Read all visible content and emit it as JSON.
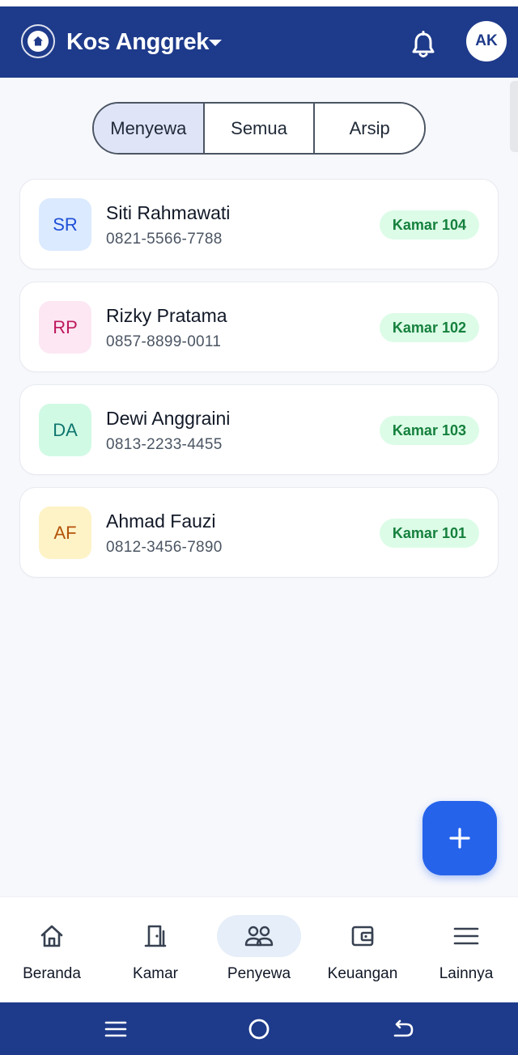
{
  "app": {
    "property_name": "Kos Anggrek",
    "user_initials": "AK"
  },
  "icons": {
    "logo": "home-circle-icon",
    "dropdown": "caret-down-icon",
    "notifications": "bell-icon",
    "fab": "plus-icon"
  },
  "filter_tabs": [
    {
      "label": "Menyewa",
      "active": true
    },
    {
      "label": "Semua",
      "active": false
    },
    {
      "label": "Arsip",
      "active": false
    }
  ],
  "tenants": [
    {
      "initials": "SR",
      "name": "Siti Rahmawati",
      "phone": "0821-5566-7788",
      "room": "Kamar 104",
      "avatar_bg": "#dbeafe",
      "avatar_fg": "#1d4ed8"
    },
    {
      "initials": "RP",
      "name": "Rizky Pratama",
      "phone": "0857-8899-0011",
      "room": "Kamar 102",
      "avatar_bg": "#fce7f3",
      "avatar_fg": "#be185d"
    },
    {
      "initials": "DA",
      "name": "Dewi Anggraini",
      "phone": "0813-2233-4455",
      "room": "Kamar 103",
      "avatar_bg": "#d1fae5",
      "avatar_fg": "#0f766e"
    },
    {
      "initials": "AF",
      "name": "Ahmad Fauzi",
      "phone": "0812-3456-7890",
      "room": "Kamar 101",
      "avatar_bg": "#fef3c7",
      "avatar_fg": "#b45309"
    }
  ],
  "bottom_nav": [
    {
      "label": "Beranda",
      "icon": "home-icon",
      "active": false
    },
    {
      "label": "Kamar",
      "icon": "door-icon",
      "active": false
    },
    {
      "label": "Penyewa",
      "icon": "people-icon",
      "active": true
    },
    {
      "label": "Keuangan",
      "icon": "wallet-icon",
      "active": false
    },
    {
      "label": "Lainnya",
      "icon": "menu-icon",
      "active": false
    }
  ],
  "colors": {
    "header": "#1e3a8a",
    "accent": "#2563eb",
    "badge_bg": "#dcfce7",
    "badge_fg": "#15803d"
  }
}
